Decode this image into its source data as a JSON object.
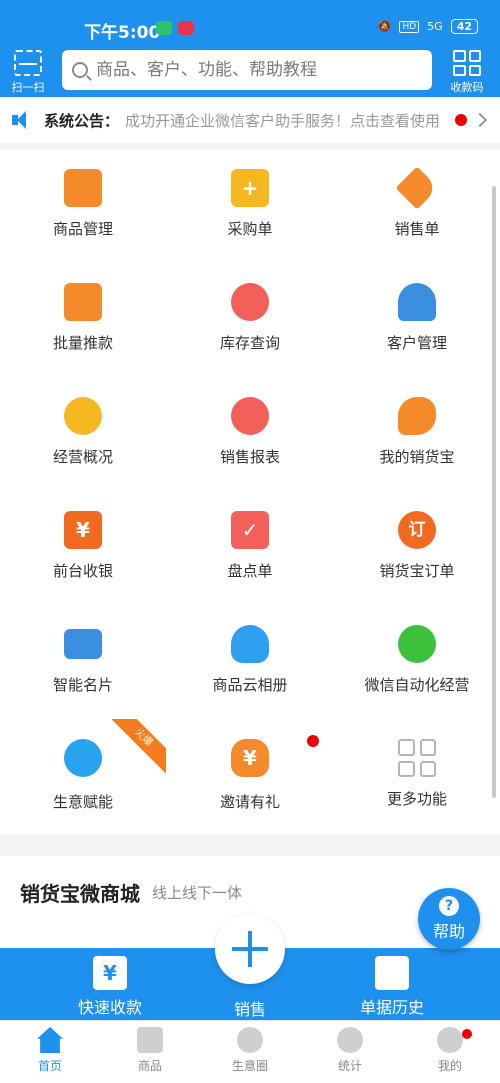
{
  "status": {
    "time": "下午5:00",
    "hd": "HD",
    "net": "5G",
    "battery": "42"
  },
  "header": {
    "scan_label": "扫一扫",
    "search_placeholder": "商品、客户、功能、帮助教程",
    "qr_label": "收款码"
  },
  "notice": {
    "label": "系统公告：",
    "text": "成功开通企业微信客户助手服务！点击查看使用"
  },
  "grid": [
    {
      "label": "商品管理",
      "icon": "shopping-bag-icon"
    },
    {
      "label": "采购单",
      "icon": "purchase-bag-icon"
    },
    {
      "label": "销售单",
      "icon": "price-tag-icon"
    },
    {
      "label": "批量推款",
      "icon": "clipboard-share-icon"
    },
    {
      "label": "库存查询",
      "icon": "home-search-icon"
    },
    {
      "label": "客户管理",
      "icon": "person-icon"
    },
    {
      "label": "经营概况",
      "icon": "growth-chart-icon"
    },
    {
      "label": "销售报表",
      "icon": "report-tag-icon"
    },
    {
      "label": "我的销货宝",
      "icon": "sales-bao-icon"
    },
    {
      "label": "前台收银",
      "icon": "yuan-register-icon"
    },
    {
      "label": "盘点单",
      "icon": "inventory-check-icon"
    },
    {
      "label": "销货宝订单",
      "icon": "order-icon"
    },
    {
      "label": "智能名片",
      "icon": "business-card-icon"
    },
    {
      "label": "商品云相册",
      "icon": "cloud-album-icon"
    },
    {
      "label": "微信自动化经营",
      "icon": "wechat-auto-icon"
    },
    {
      "label": "生意赋能",
      "icon": "clover-icon",
      "ribbon": "火爆"
    },
    {
      "label": "邀请有礼",
      "icon": "money-bag-icon",
      "glyph": "¥"
    },
    {
      "label": "更多功能",
      "icon": "more-grid-icon"
    }
  ],
  "glyphs": {
    "purchase": "+",
    "yuan": "¥",
    "order": "订"
  },
  "shop": {
    "title": "销货宝微商城",
    "subtitle": "线上线下一体"
  },
  "help": {
    "label": "帮助",
    "glyph": "?"
  },
  "actions": {
    "quick_pay": "快速收款",
    "quick_pay_glyph": "¥",
    "sale": "销售",
    "history": "单据历史"
  },
  "tabs": [
    {
      "label": "首页",
      "active": true
    },
    {
      "label": "商品"
    },
    {
      "label": "生意圈"
    },
    {
      "label": "统计"
    },
    {
      "label": "我的"
    }
  ],
  "colors": {
    "brand": "#1e90ee",
    "orange": "#f58a2a",
    "yellow": "#f6b820",
    "red": "#f26059",
    "badge": "#e00000"
  }
}
